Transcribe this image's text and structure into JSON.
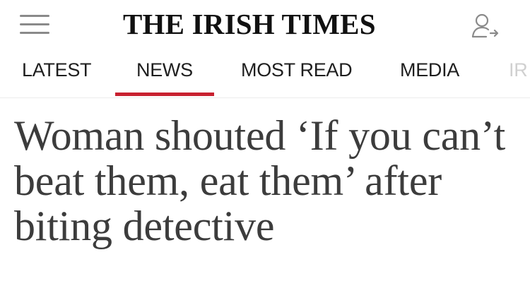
{
  "header": {
    "brand": "THE IRISH TIMES",
    "menu_icon": "hamburger-menu-icon",
    "account_icon": "user-signin-icon"
  },
  "nav": {
    "tabs": [
      {
        "label": "LATEST",
        "active": false
      },
      {
        "label": "NEWS",
        "active": true
      },
      {
        "label": "MOST READ",
        "active": false
      },
      {
        "label": "MEDIA",
        "active": false
      },
      {
        "label": "IR",
        "active": false
      }
    ],
    "accent_color": "#c8202f"
  },
  "article": {
    "headline": "Woman shouted ‘If you can’t beat them, eat them’ after biting detective"
  }
}
